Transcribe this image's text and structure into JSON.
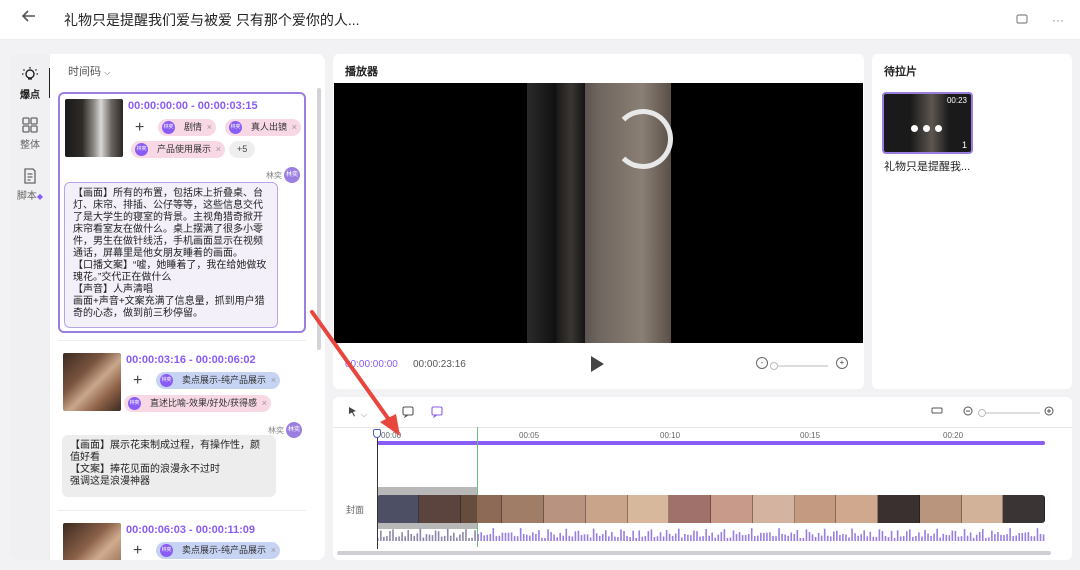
{
  "header": {
    "title": "礼物只是提醒我们爱与被爱 只有那个爱你的人...",
    "icons": [
      "back-arrow-icon",
      "window-icon",
      "more-icon"
    ]
  },
  "nav": {
    "items": [
      {
        "label": "爆点",
        "icon": "bulb-icon",
        "active": true
      },
      {
        "label": "整体",
        "icon": "grid-icon",
        "active": false
      },
      {
        "label": "脚本",
        "icon": "script-icon",
        "active": false
      }
    ]
  },
  "list": {
    "sort_label": "时间码",
    "cards": [
      {
        "timecode": "00:00:00:00 - 00:00:03:15",
        "tags": [
          "剧情",
          "真人出镜",
          "产品使用展示"
        ],
        "more": "+5",
        "tag_avatar": "林奕",
        "author": "林奕",
        "author_avatar": "林奕",
        "note": "【画面】所有的布置，包括床上折叠桌、台灯、床帘、排插、公仔等等，这些信息交代了是大学生的寝室的背景。主视角猎奇掀开床帘看室友在做什么。桌上摆满了很多小零件，男生在做针线活，手机画面显示在视频通话，屏幕里是他女朋友睡着的画面。\n【口播文案】“嘘，她睡着了，我在给她做玫瑰花。”交代正在做什么\n【声音】人声清唱\n画面+声音+文案充满了信息量，抓到用户猎奇的心态，做到前三秒停留。"
      },
      {
        "timecode": "00:00:03:16 - 00:00:06:02",
        "tags": [
          "卖点展示-纯产品展示",
          "直述比喻-效果/好处/获得感"
        ],
        "tag_avatar": "林奕",
        "author": "林奕",
        "author_avatar": "林奕",
        "note": "【画面】展示花束制成过程，有操作性，颜值好看\n【文案】捧花见面的浪漫永不过时\n强调这是浪漫神器"
      },
      {
        "timecode": "00:00:06:03 - 00:00:11:09",
        "tags": [
          "卖点展示-纯产品展示"
        ],
        "tag_avatar": "林奕"
      }
    ]
  },
  "player": {
    "title": "播放器",
    "current_time": "00:00:00:00",
    "total_time": "00:00:23:16"
  },
  "pending": {
    "title": "待拉片",
    "item_name": "礼物只是提醒我...",
    "duration": "00:23",
    "count": "1"
  },
  "timeline": {
    "ticks": [
      "00:00",
      "00:05",
      "00:10",
      "00:15",
      "00:20"
    ],
    "cover_label": "封面"
  },
  "colors": {
    "accent": "#8a5cf6",
    "tag_red": "#f7d8e4",
    "tag_blue": "#c6d3f3",
    "annotation_arrow": "#e8453c"
  }
}
